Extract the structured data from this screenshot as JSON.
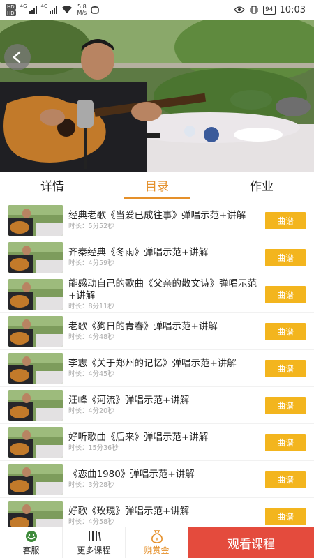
{
  "status_bar": {
    "hd1": "HD",
    "hd2": "HD",
    "net1": "4G",
    "net2": "4G",
    "speed_value": "5.8",
    "speed_unit": "M/s",
    "battery": "94",
    "time": "10:03"
  },
  "tabs": [
    {
      "label": "详情"
    },
    {
      "label": "目录"
    },
    {
      "label": "作业"
    }
  ],
  "active_tab": 1,
  "duration_prefix": "时长：",
  "lessons": [
    {
      "title": "经典老歌《当爱已成往事》弹唱示范+讲解",
      "duration": "5分52秒",
      "button": "曲谱"
    },
    {
      "title": "齐秦经典《冬雨》弹唱示范+讲解",
      "duration": "4分59秒",
      "button": "曲谱"
    },
    {
      "title": "能感动自己的歌曲《父亲的散文诗》弹唱示范+讲解",
      "duration": "8分11秒",
      "button": "曲谱"
    },
    {
      "title": "老歌《狗日的青春》弹唱示范+讲解",
      "duration": "4分48秒",
      "button": "曲谱"
    },
    {
      "title": "李志《关于郑州的记忆》弹唱示范+讲解",
      "duration": "4分45秒",
      "button": "曲谱"
    },
    {
      "title": "汪峰《河流》弹唱示范+讲解",
      "duration": "4分20秒",
      "button": "曲谱"
    },
    {
      "title": "好听歌曲《后来》弹唱示范+讲解",
      "duration": "15分36秒",
      "button": "曲谱"
    },
    {
      "title": "《恋曲1980》弹唱示范+讲解",
      "duration": "3分28秒",
      "button": "曲谱"
    },
    {
      "title": "好歌《玫瑰》弹唱示范+讲解",
      "duration": "4分58秒",
      "button": "曲谱"
    }
  ],
  "bottom_bar": {
    "service": "客服",
    "more_courses": "更多课程",
    "earn": "赚赏金",
    "watch": "观看课程"
  },
  "colors": {
    "accent": "#e5902a",
    "score_button": "#f3b51e",
    "watch_button": "#e44b3d"
  },
  "icons": {
    "back": "back-arrow-icon",
    "service": "headset-icon",
    "more_courses": "library-icon",
    "earn": "money-bag-icon"
  }
}
